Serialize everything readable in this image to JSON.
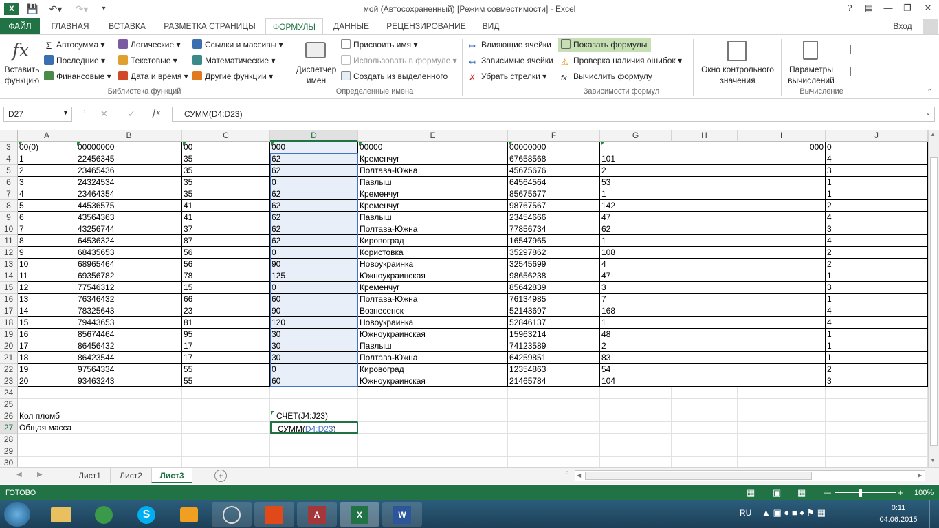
{
  "titlebar": {
    "title": "мой (Автосохраненный)  [Режим совместимости] - Excel",
    "help": "?",
    "account": "Вход"
  },
  "tabs": [
    "ФАЙЛ",
    "ГЛАВНАЯ",
    "ВСТАВКА",
    "РАЗМЕТКА СТРАНИЦЫ",
    "ФОРМУЛЫ",
    "ДАННЫЕ",
    "РЕЦЕНЗИРОВАНИЕ",
    "ВИД"
  ],
  "ribbon": {
    "insert_fn": "Вставить функцию",
    "lib": [
      "Автосумма",
      "Последние",
      "Финансовые",
      "Логические",
      "Текстовые",
      "Дата и время",
      "Ссылки и массивы",
      "Математические",
      "Другие функции"
    ],
    "lib_label": "Библиотека функций",
    "names": {
      "manager": "Диспетчер имен",
      "assign": "Присвоить имя",
      "use": "Использовать в формуле",
      "create": "Создать из выделенного",
      "label": "Определенные имена"
    },
    "audit": {
      "precedents": "Влияющие ячейки",
      "dependents": "Зависимые ячейки",
      "remove": "Убрать стрелки",
      "show": "Показать формулы",
      "check": "Проверка наличия ошибок",
      "eval": "Вычислить формулу",
      "label": "Зависимости формул"
    },
    "watch": "Окно контрольного значения",
    "calc": {
      "options": "Параметры вычислений",
      "label": "Вычисление"
    }
  },
  "formula_bar": {
    "namebox": "D27",
    "fx": "fx",
    "formula": "=СУММ(D4:D23)"
  },
  "columns": [
    "A",
    "B",
    "C",
    "D",
    "E",
    "F",
    "G",
    "H",
    "I",
    "J"
  ],
  "rows": [
    {
      "n": "3",
      "c": [
        "00(0)",
        "00000000",
        "00",
        "000",
        "00000",
        "00000000",
        "",
        "",
        "000",
        "0"
      ]
    },
    {
      "n": "4",
      "c": [
        "1",
        "22456345",
        "35",
        "62",
        "Кременчуг",
        "67658568",
        "101",
        "",
        "",
        "4"
      ]
    },
    {
      "n": "5",
      "c": [
        "2",
        "23465436",
        "35",
        "62",
        "Полтава-Южна",
        "45675676",
        "2",
        "",
        "",
        "3"
      ]
    },
    {
      "n": "6",
      "c": [
        "3",
        "24324534",
        "35",
        "0",
        "Павлыш",
        "64564564",
        "53",
        "",
        "",
        "1"
      ]
    },
    {
      "n": "7",
      "c": [
        "4",
        "23464354",
        "35",
        "62",
        "Кременчуг",
        "85675677",
        "1",
        "",
        "",
        "1"
      ]
    },
    {
      "n": "8",
      "c": [
        "5",
        "44536575",
        "41",
        "62",
        "Кременчуг",
        "98767567",
        "142",
        "",
        "",
        "2"
      ]
    },
    {
      "n": "9",
      "c": [
        "6",
        "43564363",
        "41",
        "62",
        "Павлыш",
        "23454666",
        "47",
        "",
        "",
        "4"
      ]
    },
    {
      "n": "10",
      "c": [
        "7",
        "43256744",
        "37",
        "62",
        "Полтава-Южна",
        "77856734",
        "62",
        "",
        "",
        "3"
      ]
    },
    {
      "n": "11",
      "c": [
        "8",
        "64536324",
        "87",
        "62",
        "Кировоград",
        "16547965",
        "1",
        "",
        "",
        "4"
      ]
    },
    {
      "n": "12",
      "c": [
        "9",
        "68435653",
        "56",
        "0",
        "Користовка",
        "35297862",
        "108",
        "",
        "",
        "2"
      ]
    },
    {
      "n": "13",
      "c": [
        "10",
        "68965464",
        "56",
        "90",
        "Новоукраинка",
        "32545699",
        "4",
        "",
        "",
        "2"
      ]
    },
    {
      "n": "14",
      "c": [
        "11",
        "69356782",
        "78",
        "125",
        "Южноукраинская",
        "98656238",
        "47",
        "",
        "",
        "1"
      ]
    },
    {
      "n": "15",
      "c": [
        "12",
        "77546312",
        "15",
        "0",
        "Кременчуг",
        "85642839",
        "3",
        "",
        "",
        "3"
      ]
    },
    {
      "n": "16",
      "c": [
        "13",
        "76346432",
        "66",
        "60",
        "Полтава-Южна",
        "76134985",
        "7",
        "",
        "",
        "1"
      ]
    },
    {
      "n": "17",
      "c": [
        "14",
        "78325643",
        "23",
        "90",
        "Вознесенск",
        "52143697",
        "168",
        "",
        "",
        "4"
      ]
    },
    {
      "n": "18",
      "c": [
        "15",
        "79443653",
        "81",
        "120",
        "Новоукраинка",
        "52846137",
        "1",
        "",
        "",
        "4"
      ]
    },
    {
      "n": "19",
      "c": [
        "16",
        "85674464",
        "95",
        "30",
        "Южноукраинская",
        "15963214",
        "48",
        "",
        "",
        "1"
      ]
    },
    {
      "n": "20",
      "c": [
        "17",
        "86456432",
        "17",
        "30",
        "Павлыш",
        "74123589",
        "2",
        "",
        "",
        "1"
      ]
    },
    {
      "n": "21",
      "c": [
        "18",
        "86423544",
        "17",
        "30",
        "Полтава-Южна",
        "64259851",
        "83",
        "",
        "",
        "1"
      ]
    },
    {
      "n": "22",
      "c": [
        "19",
        "97564334",
        "55",
        "0",
        "Кировоград",
        "12354863",
        "54",
        "",
        "",
        "2"
      ]
    },
    {
      "n": "23",
      "c": [
        "20",
        "93463243",
        "55",
        "60",
        "Южноукраинская",
        "21465784",
        "104",
        "",
        "",
        "3"
      ]
    },
    {
      "n": "24",
      "c": [
        "",
        "",
        "",
        "",
        "",
        "",
        "",
        "",
        "",
        ""
      ]
    },
    {
      "n": "25",
      "c": [
        "",
        "",
        "",
        "",
        "",
        "",
        "",
        "",
        "",
        ""
      ]
    },
    {
      "n": "26",
      "c": [
        "Кол пломб",
        "",
        "",
        "=СЧЁТ(J4:J23)",
        "",
        "",
        "",
        "",
        "",
        ""
      ]
    },
    {
      "n": "27",
      "c": [
        "Общая масса",
        "",
        "",
        "",
        "",
        "",
        "",
        "",
        "",
        ""
      ]
    },
    {
      "n": "28",
      "c": [
        "",
        "",
        "",
        "",
        "",
        "",
        "",
        "",
        "",
        ""
      ]
    },
    {
      "n": "29",
      "c": [
        "",
        "",
        "",
        "",
        "",
        "",
        "",
        "",
        "",
        ""
      ]
    },
    {
      "n": "30",
      "c": [
        "",
        "",
        "",
        "",
        "",
        "",
        "",
        "",
        "",
        ""
      ]
    }
  ],
  "d27": {
    "pre": "=СУММ(",
    "ref": "D4:D23",
    "post": ")",
    "ref_color": "#4472c4"
  },
  "sheets": [
    "Лист1",
    "Лист2",
    "Лист3"
  ],
  "status": {
    "ready": "ГОТОВО",
    "zoom": "100%"
  },
  "taskbar": {
    "lang": "RU",
    "time": "0:11",
    "date": "04.06.2015"
  },
  "colors": {
    "accent": "#217346"
  }
}
